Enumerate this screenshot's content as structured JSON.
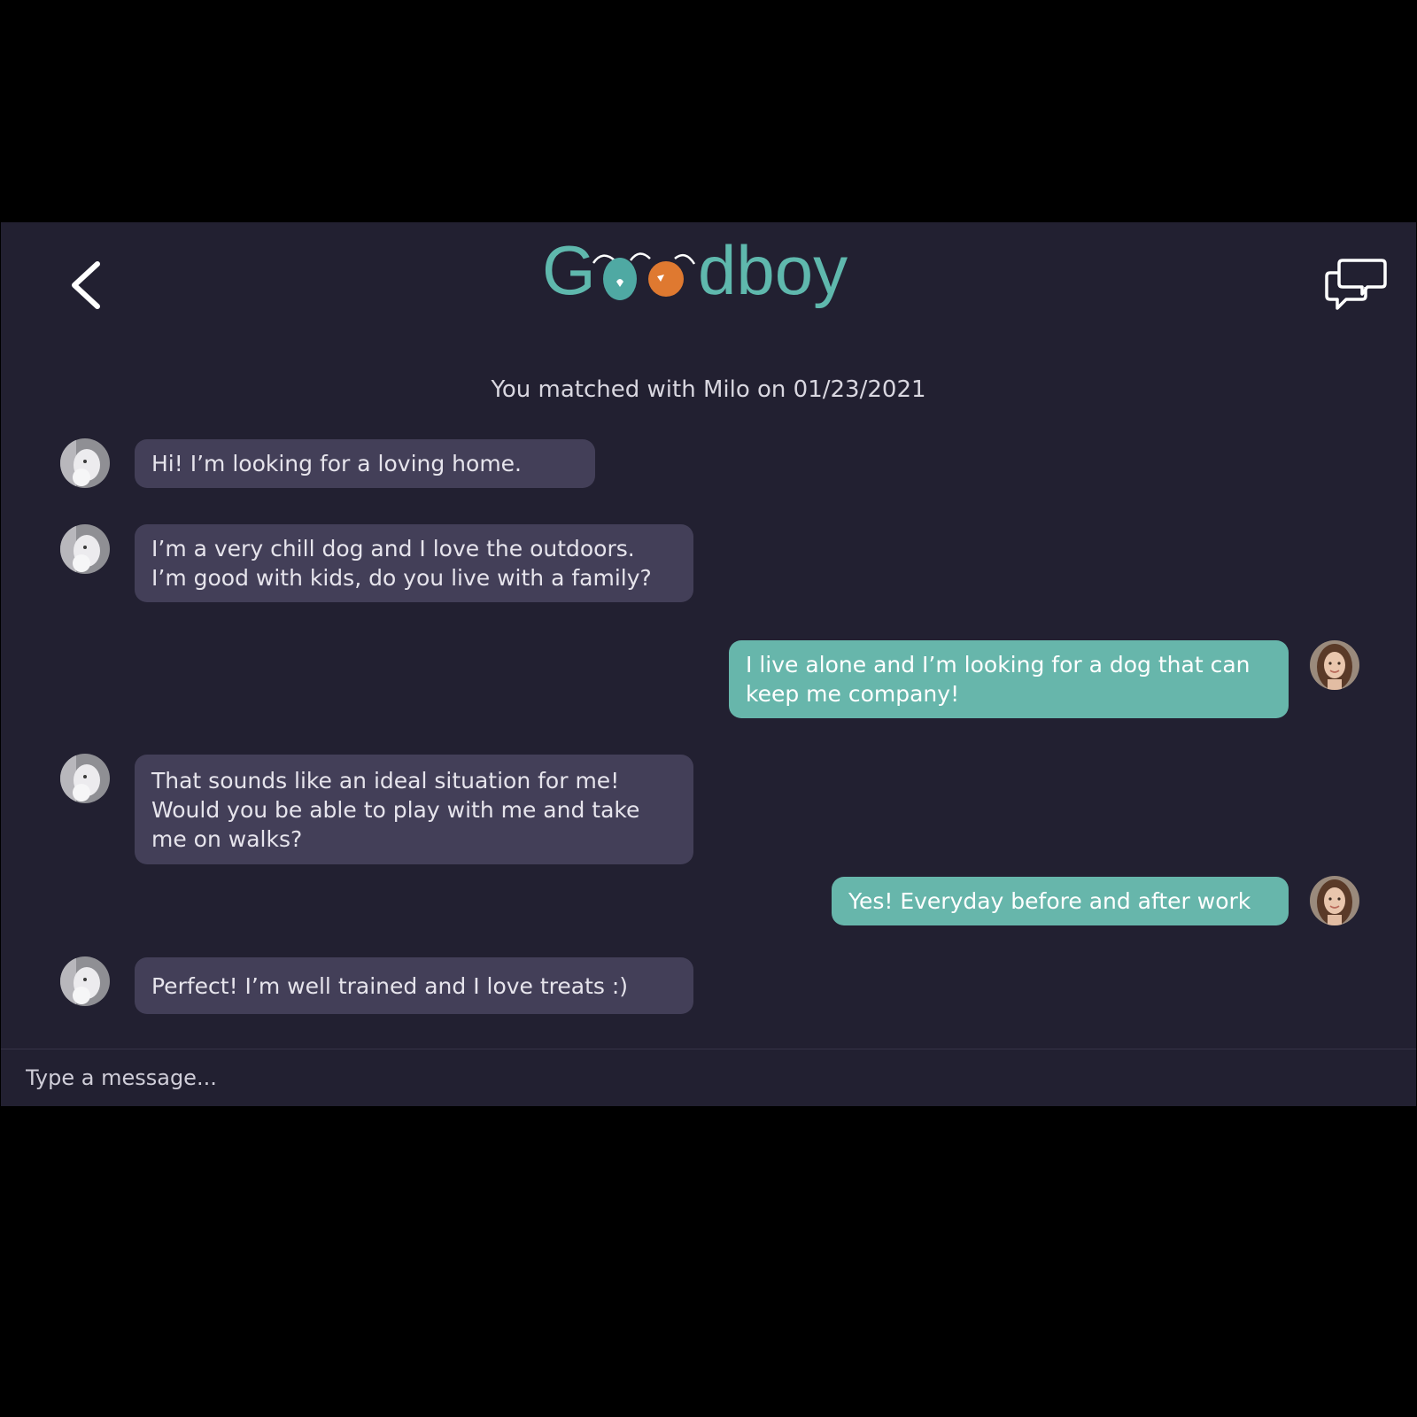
{
  "header": {
    "app_name": "Goodboy",
    "back_icon": "chevron-left-icon",
    "chat_list_icon": "chat-bubbles-icon",
    "brand_color": "#5fb8ad",
    "accent_color": "#e07a2f"
  },
  "conversation": {
    "match_notice": "You matched with Milo on 01/23/2021",
    "match_name": "Milo",
    "messages": [
      {
        "sender": "dog",
        "text": "Hi! I’m looking for a loving home."
      },
      {
        "sender": "dog",
        "text": "I’m a very chill dog and I love the outdoors. I’m good with kids, do you live with a family?"
      },
      {
        "sender": "user",
        "text": "I live alone and I’m looking for a dog that can keep me company!"
      },
      {
        "sender": "dog",
        "text": "That sounds like an ideal situation for me! Would you be able to play with me and take me on walks?"
      },
      {
        "sender": "user",
        "text": "Yes! Everyday before and after work"
      },
      {
        "sender": "dog",
        "text": "Perfect! I’m well trained and I love treats :)"
      }
    ]
  },
  "composer": {
    "placeholder": "Type a message..."
  },
  "colors": {
    "background": "#222031",
    "incoming_bubble": "#433f58",
    "outgoing_bubble": "#67b6ab"
  }
}
